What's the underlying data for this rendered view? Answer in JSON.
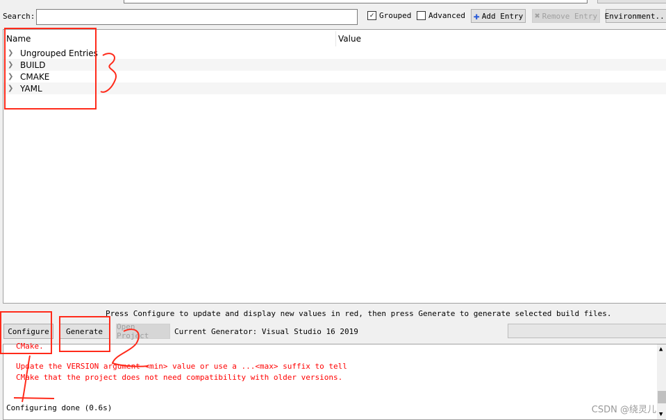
{
  "toolbar": {
    "search_label": "Search:",
    "search_value": "",
    "grouped_label": "Grouped",
    "grouped_checked": true,
    "advanced_label": "Advanced",
    "advanced_checked": false,
    "add_entry_label": "Add Entry",
    "remove_entry_label": "Remove Entry",
    "environment_label": "Environment..."
  },
  "tree": {
    "columns": [
      "Name",
      "Value"
    ],
    "rows": [
      {
        "label": "Ungrouped Entries"
      },
      {
        "label": "BUILD"
      },
      {
        "label": "CMAKE"
      },
      {
        "label": "YAML"
      }
    ]
  },
  "status_text": "Press Configure to update and display new values in red, then press Generate to generate selected build files.",
  "actions": {
    "configure_label": "Configure",
    "generate_label": "Generate",
    "open_project_label": "Open Project",
    "current_generator": "Current Generator: Visual Studio 16 2019"
  },
  "output": {
    "lines": [
      "CMake.",
      "Update the VERSION argument <min> value or use a ...<max> suffix to tell",
      "CMake that the project does not need compatibility with older versions.",
      "Configuring done (0.6s)"
    ]
  },
  "watermark": "CSDN @绕灵儿",
  "annotations": {
    "color": "#ff2a1a",
    "marks": [
      "1",
      "2",
      "3"
    ]
  }
}
